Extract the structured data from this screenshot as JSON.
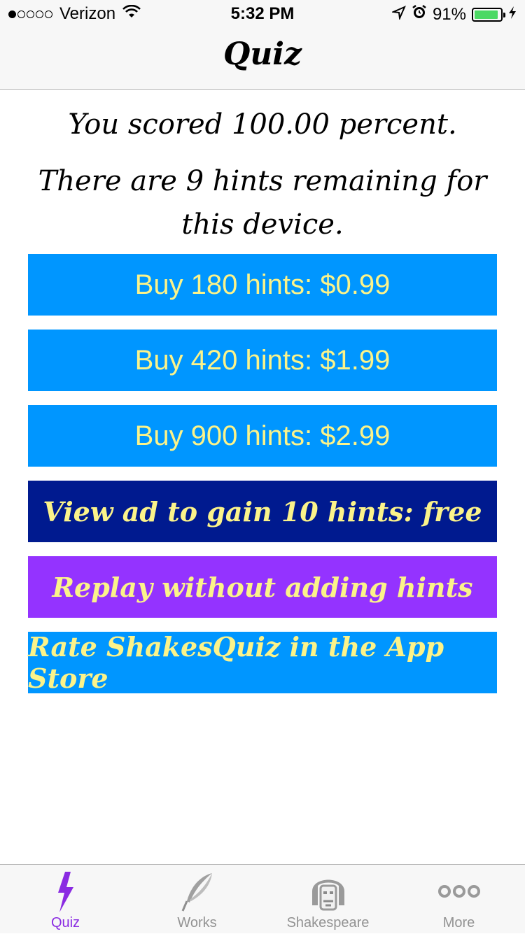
{
  "status_bar": {
    "carrier": "Verizon",
    "time": "5:32 PM",
    "battery": "91%",
    "battery_level": 0.91,
    "icons": [
      "signal-dots",
      "wifi-icon",
      "location-arrow-icon",
      "alarm-icon",
      "battery-icon",
      "charging-bolt-icon"
    ]
  },
  "nav": {
    "title": "Quiz"
  },
  "main": {
    "score_text": "You scored 100.00 percent.",
    "hints_text": "There are 9 hints remaining for this device."
  },
  "buttons": {
    "buy_180": "Buy 180 hints: $0.99",
    "buy_420": "Buy 420 hints: $1.99",
    "buy_900": "Buy 900 hints: $2.99",
    "view_ad": "View ad to gain 10 hints: free",
    "replay": "Replay without adding hints",
    "rate": "Rate ShakesQuiz in the App Store"
  },
  "tabs": [
    {
      "label": "Quiz",
      "icon": "lightning-bolt-icon",
      "active": true
    },
    {
      "label": "Works",
      "icon": "quill-icon",
      "active": false
    },
    {
      "label": "Shakespeare",
      "icon": "shakespeare-face-icon",
      "active": false
    },
    {
      "label": "More",
      "icon": "more-dots-icon",
      "active": false
    }
  ],
  "colors": {
    "button_blue": "#0096ff",
    "button_navy": "#001a8f",
    "button_purple": "#9433ff",
    "button_text": "#fbf38a",
    "tab_active": "#8a2be2",
    "tab_inactive": "#929292"
  }
}
